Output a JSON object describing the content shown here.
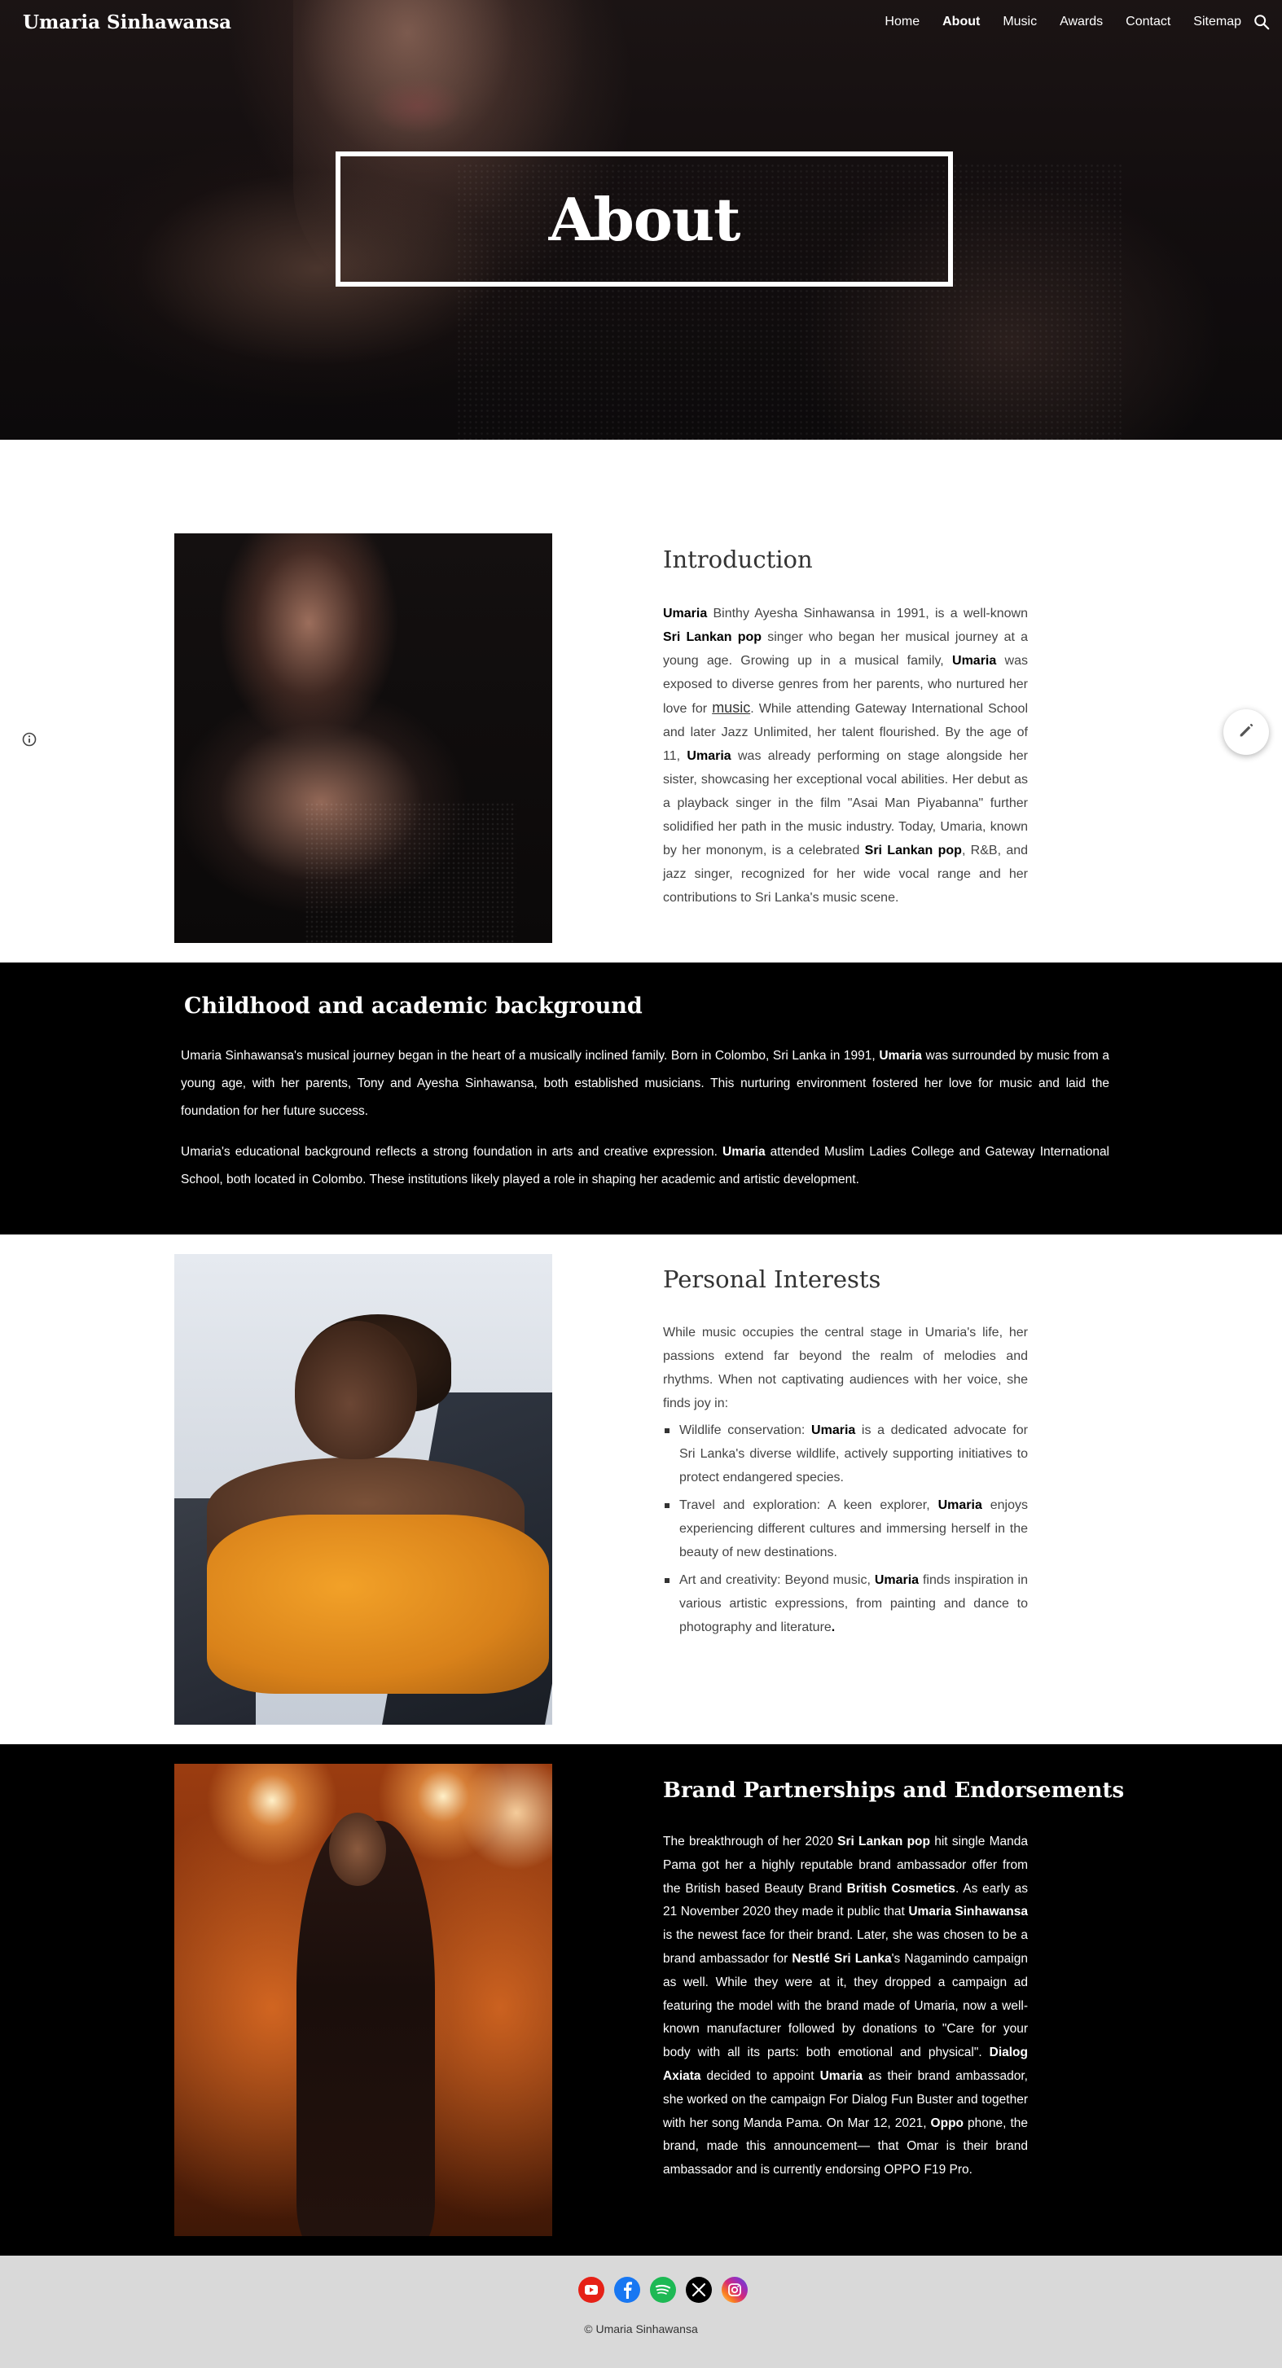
{
  "site": {
    "title": "Umaria Sinhawansa"
  },
  "nav": {
    "items": [
      {
        "label": "Home"
      },
      {
        "label": "About"
      },
      {
        "label": "Music"
      },
      {
        "label": "Awards"
      },
      {
        "label": "Contact"
      },
      {
        "label": "Sitemap"
      }
    ],
    "active": "About",
    "search_icon": "search-icon"
  },
  "hero": {
    "title": "About"
  },
  "intro": {
    "heading": "Introduction",
    "segments": [
      {
        "b": true,
        "t": "Umaria"
      },
      {
        "t": " Binthy Ayesha Sinhawansa in 1991, is a well-known "
      },
      {
        "b": true,
        "t": "Sri Lankan pop"
      },
      {
        "t": " singer who began her musical journey at a young age. Growing up in a musical family, "
      },
      {
        "b": true,
        "t": "Umaria"
      },
      {
        "t": " was exposed to diverse genres from her parents, who nurtured her love for "
      },
      {
        "u": true,
        "t": "music"
      },
      {
        "t": ". While attending Gateway International School and later Jazz Unlimited, her talent flourished. By the age of 11, "
      },
      {
        "b": true,
        "t": "Umaria"
      },
      {
        "t": " was already performing on stage alongside her sister, showcasing her exceptional vocal abilities. Her debut as a playback singer in the film \"Asai Man Piyabanna\" further solidified her path in the music industry. Today, Umaria, known by her mononym, is a celebrated "
      },
      {
        "b": true,
        "t": "Sri Lankan pop"
      },
      {
        "t": ", R&B, and jazz singer, recognized for her wide vocal range and her contributions to Sri Lanka's music scene."
      }
    ]
  },
  "childhood": {
    "heading": "Childhood and academic background",
    "p1": [
      {
        "t": "Umaria Sinhawansa's musical journey began in the heart of a musically inclined family. Born in Colombo, Sri Lanka in 1991, "
      },
      {
        "b": true,
        "t": "Umaria"
      },
      {
        "t": " was surrounded by music from a young age, with her parents, Tony and Ayesha Sinhawansa, both established musicians. This nurturing environment fostered her love for music and laid the foundation for her future success."
      }
    ],
    "p2": [
      {
        "t": "Umaria's educational background reflects a strong foundation in arts and creative expression. "
      },
      {
        "b": true,
        "t": "Umaria"
      },
      {
        "t": " attended Muslim Ladies College and Gateway International School, both located in Colombo. These institutions likely played a role in shaping her academic and artistic development."
      }
    ]
  },
  "interests": {
    "heading": "Personal Interests",
    "intro": "While music occupies the central stage in Umaria's life, her passions extend far beyond the realm of melodies and rhythms. When not captivating audiences with her voice, she finds joy in:",
    "items": [
      [
        {
          "t": "Wildlife conservation: "
        },
        {
          "b": true,
          "t": "Umaria"
        },
        {
          "t": " is a dedicated advocate for Sri Lanka's diverse wildlife, actively supporting initiatives to protect endangered species."
        }
      ],
      [
        {
          "t": "Travel and exploration: A keen explorer, "
        },
        {
          "b": true,
          "t": "Umaria"
        },
        {
          "t": " enjoys experiencing different cultures and immersing herself in the beauty of new destinations."
        }
      ],
      [
        {
          "t": "Art and creativity: Beyond music, "
        },
        {
          "b": true,
          "t": "Umaria"
        },
        {
          "t": " finds inspiration in various artistic expressions, from painting and dance to photography and literature"
        },
        {
          "b": true,
          "t": "."
        }
      ]
    ]
  },
  "brand": {
    "heading": "Brand Partnerships and Endorsements",
    "segments": [
      {
        "t": "The breakthrough of her 2020 "
      },
      {
        "b": true,
        "t": "Sri Lankan pop"
      },
      {
        "t": " hit single Manda Pama got her a highly reputable brand ambassador offer from the British based Beauty Brand "
      },
      {
        "b": true,
        "t": "British Cosmetics"
      },
      {
        "t": ". As early as 21 November 2020 they made it public that "
      },
      {
        "b": true,
        "t": "Umaria Sinhawansa"
      },
      {
        "t": " is the newest face for their brand. Later, she was chosen to be a brand ambassador for "
      },
      {
        "b": true,
        "t": "Nestlé Sri Lanka"
      },
      {
        "t": "'s Nagamindo campaign as well. While they were at it, they dropped a campaign ad featuring the model with the brand made of Umaria, now a well-known manufacturer followed by donations to \"Care for your body with all its parts: both emotional and physical\". "
      },
      {
        "b": true,
        "t": "Dialog Axiata"
      },
      {
        "t": " decided to appoint "
      },
      {
        "b": true,
        "t": "Umaria"
      },
      {
        "t": " as their brand ambassador, she worked on the campaign For Dialog Fun Buster and together with her song Manda Pama. On Mar 12, 2021, "
      },
      {
        "b": true,
        "t": "Oppo"
      },
      {
        "t": " phone, the brand, made this announcement— that Omar is their brand ambassador and is currently endorsing OPPO F19 Pro."
      }
    ]
  },
  "footer": {
    "socials": [
      {
        "icon": "youtube-icon",
        "color": "#e62117"
      },
      {
        "icon": "facebook-icon",
        "color": "#1877f2"
      },
      {
        "icon": "spotify-icon",
        "color": "#1db954"
      },
      {
        "icon": "x-icon",
        "color": "#000000"
      },
      {
        "icon": "instagram-icon",
        "color": "#d62976"
      }
    ],
    "copyright": "© Umaria Sinhawansa"
  },
  "colors": {
    "dark_bg": "#000000",
    "footer_bg": "#d9d9d9",
    "text": "#333333"
  }
}
